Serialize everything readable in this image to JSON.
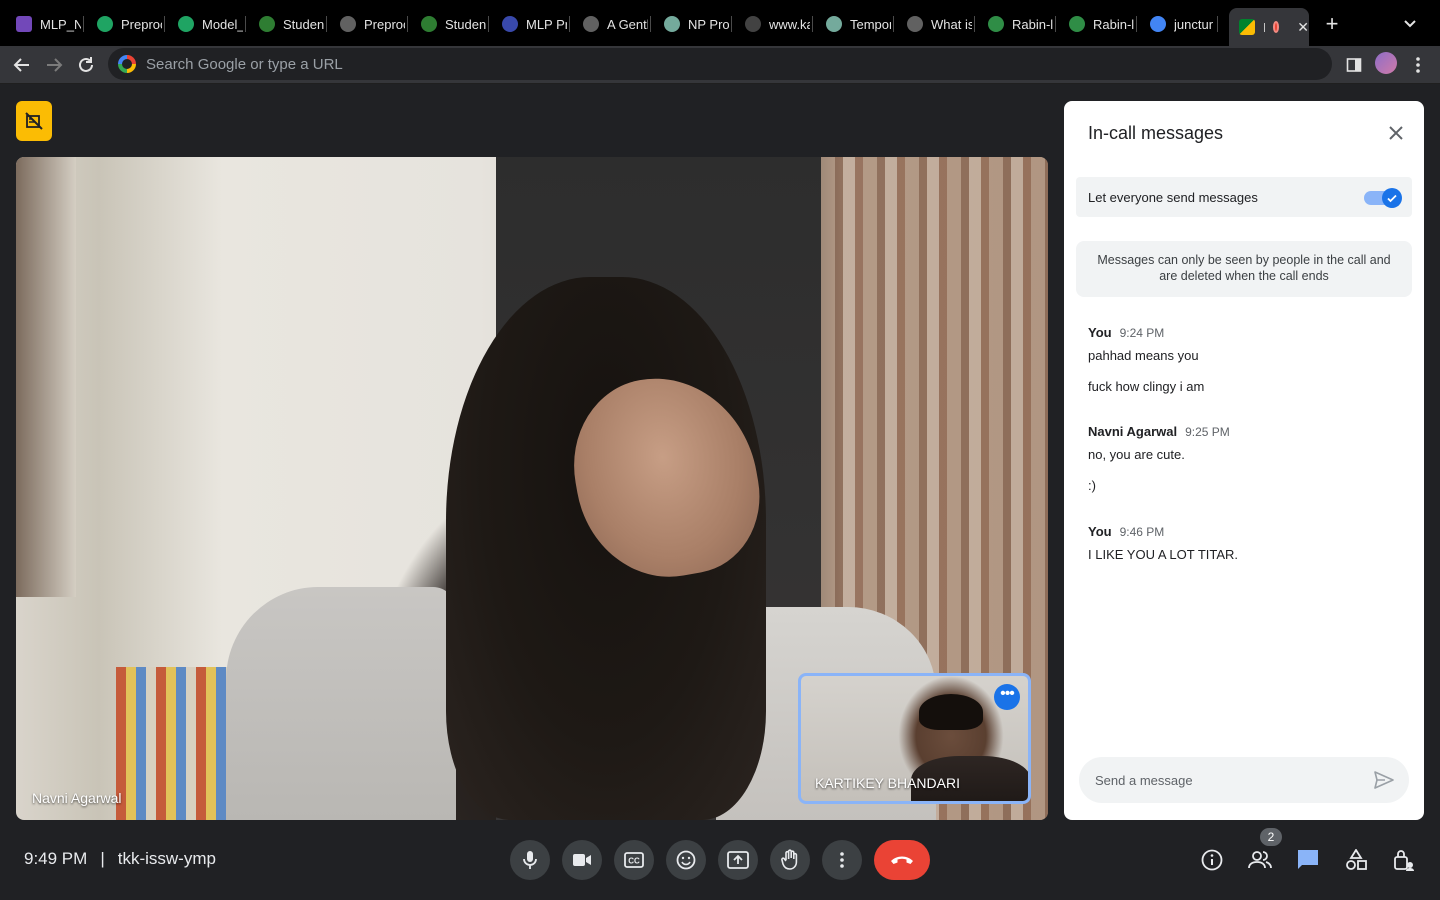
{
  "browser": {
    "tabs": [
      {
        "title": "MLP_N",
        "icon": "forms-icon",
        "color": "#7248b9"
      },
      {
        "title": "Preproc",
        "icon": "drive-icon",
        "color": "#1fa463"
      },
      {
        "title": "Model_",
        "icon": "drive-icon",
        "color": "#1fa463"
      },
      {
        "title": "Studen",
        "icon": "globe-icon",
        "color": "#2e7d32"
      },
      {
        "title": "Preproc",
        "icon": "globe-icon",
        "color": "#616161"
      },
      {
        "title": "Studen",
        "icon": "globe-icon",
        "color": "#2e7d32"
      },
      {
        "title": "MLP Pr",
        "icon": "globe-icon",
        "color": "#3949ab"
      },
      {
        "title": "A Gentl",
        "icon": "globe-icon",
        "color": "#616161"
      },
      {
        "title": "NP Pro",
        "icon": "chatgpt-icon",
        "color": "#74aa9c"
      },
      {
        "title": "www.ka",
        "icon": "k-icon",
        "color": "#424242"
      },
      {
        "title": "Tempor",
        "icon": "chatgpt-icon",
        "color": "#74aa9c"
      },
      {
        "title": "What is",
        "icon": "bike-icon",
        "color": "#616161"
      },
      {
        "title": "Rabin-l",
        "icon": "gfg-icon",
        "color": "#2f8d46"
      },
      {
        "title": "Rabin-l",
        "icon": "gfg-icon",
        "color": "#2f8d46"
      },
      {
        "title": "junctur",
        "icon": "google-icon",
        "color": "#4285f4"
      }
    ],
    "active_tab": {
      "title": "I",
      "icon": "meet-icon",
      "recording": true
    },
    "omnibox_placeholder": "Search Google or type a URL"
  },
  "meeting": {
    "main_participant": "Navni Agarwal",
    "self_participant": "KARTIKEY BHANDARI",
    "time": "9:49 PM",
    "divider": "|",
    "code": "tkk-issw-ymp",
    "people_count": "2"
  },
  "panel": {
    "title": "In-call messages",
    "toggle_label": "Let everyone send messages",
    "toggle_on": true,
    "info": "Messages can only be seen by people in the call and are deleted when the call ends",
    "messages": [
      {
        "author": "You",
        "time": "9:24 PM",
        "lines": [
          "pahhad means you",
          "fuck how clingy i am"
        ]
      },
      {
        "author": "Navni Agarwal",
        "time": "9:25 PM",
        "lines": [
          "no, you are cute.",
          ":)"
        ]
      },
      {
        "author": "You",
        "time": "9:46 PM",
        "lines": [
          "I LIKE YOU A LOT TITAR."
        ]
      }
    ],
    "composer_placeholder": "Send a message"
  },
  "colors": {
    "accent": "#1a73e8",
    "end_call": "#ea4335",
    "recording": "#fbbc04"
  }
}
